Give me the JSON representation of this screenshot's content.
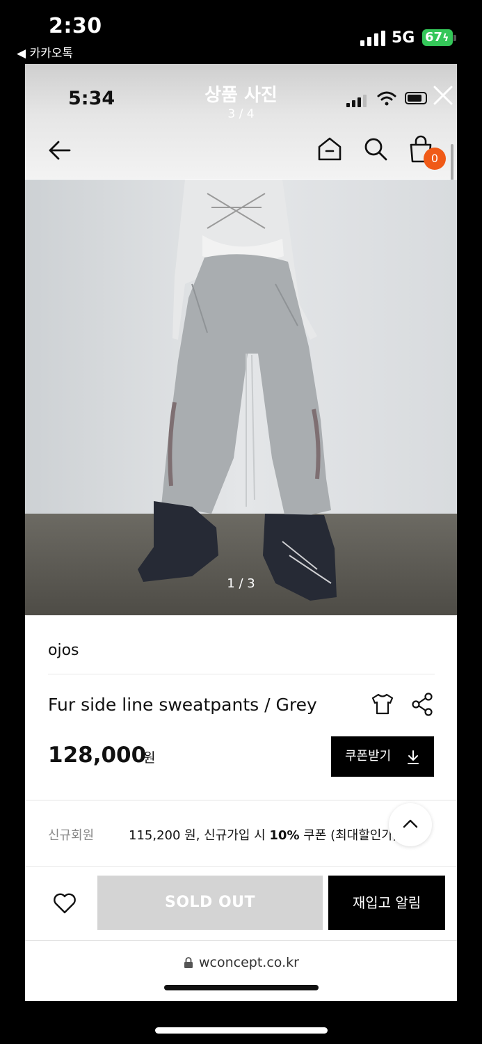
{
  "outer_status": {
    "time": "2:30",
    "back_app": "◀ 카카오톡",
    "network": "5G",
    "battery": "67"
  },
  "viewer": {
    "title": "상품 사진",
    "count": "3 / 4"
  },
  "inner_status": {
    "time": "5:34"
  },
  "header": {
    "cart_count": "0"
  },
  "photo": {
    "counter": "1 / 3"
  },
  "product": {
    "brand": "ojos",
    "name": "Fur side line sweatpants / Grey",
    "price": "128,000",
    "price_unit": "원",
    "coupon_button": "쿠폰받기"
  },
  "member": {
    "label": "신규회원",
    "price": "115,200 원, 신규가입 시 ",
    "discount": "10%",
    "coupon_text": " 쿠폰 (최대할인가,"
  },
  "actions": {
    "sold_out": "SOLD OUT",
    "restock": "재입고 알림"
  },
  "browser": {
    "url": "wconcept.co.kr"
  },
  "colors": {
    "badge": "#f05a17",
    "battery_green": "#34c759",
    "sold_out_bg": "#d4d4d4"
  }
}
